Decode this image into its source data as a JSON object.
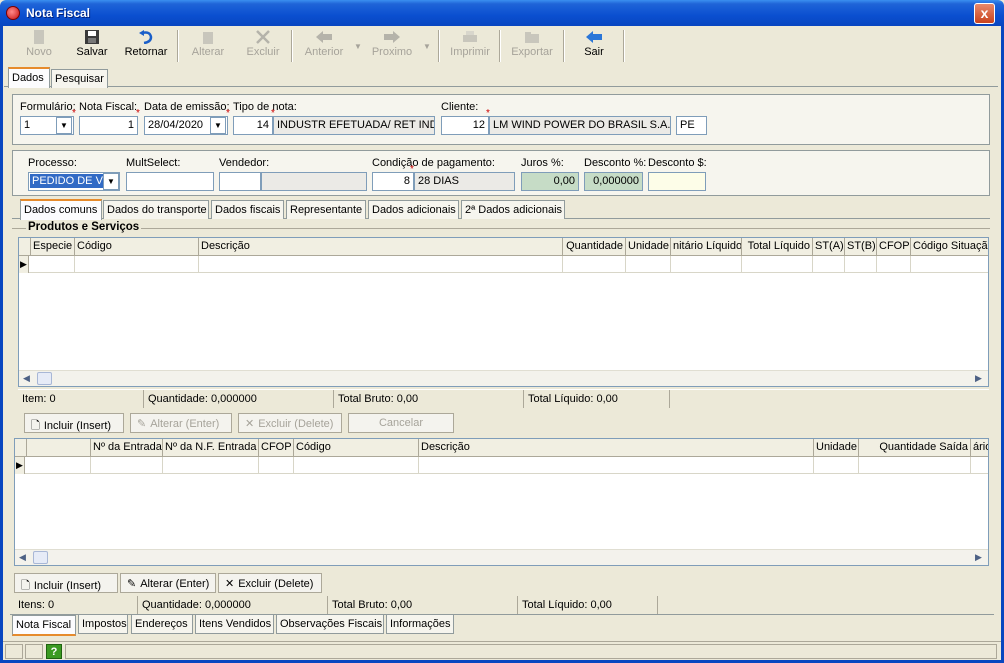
{
  "window": {
    "title": "Nota Fiscal",
    "close_label": "x"
  },
  "toolbar": {
    "novo": "Novo",
    "salvar": "Salvar",
    "retornar": "Retornar",
    "alterar": "Alterar",
    "excluir": "Excluir",
    "anterior": "Anterior",
    "proximo": "Proximo",
    "imprimir": "Imprimir",
    "exportar": "Exportar",
    "sair": "Sair"
  },
  "main_tabs": [
    "Dados",
    "Pesquisar"
  ],
  "header": {
    "formulario_label": "Formulário:",
    "formulario_value": "1",
    "nota_label": "Nota Fiscal:",
    "nota_value": "1",
    "data_label": "Data de emissão:",
    "data_value": "28/04/2020",
    "tipo_label": "Tipo de nota:",
    "tipo_code": "14",
    "tipo_desc": "INDUSTR EFETUADA/ RET IND",
    "cliente_label": "Cliente:",
    "cliente_code": "12",
    "cliente_name": "LM WIND POWER DO BRASIL S.A.",
    "cliente_uf": "PE"
  },
  "details": {
    "processo_label": "Processo:",
    "processo_value": "PEDIDO DE V",
    "multselect_label": "MultSelect:",
    "vendedor_label": "Vendedor:",
    "condicao_label": "Condição de pagamento:",
    "condicao_code": "8",
    "condicao_desc": "28 DIAS",
    "juros_label": "Juros %:",
    "juros_value": "0,00",
    "desconto_pct_label": "Desconto %:",
    "desconto_pct_value": "0,000000",
    "desconto_val_label": "Desconto $:"
  },
  "sub_tabs": [
    "Dados comuns",
    "Dados do transporte",
    "Dados fiscais",
    "Representante",
    "Dados adicionais",
    "2ª Dados adicionais"
  ],
  "produtos": {
    "title": "Produtos e Serviços",
    "columns": [
      "Especie",
      "Código",
      "Descrição",
      "Quantidade",
      "Unidade",
      "nitário Líquido",
      "Total Líquido",
      "ST(A)",
      "ST(B)",
      "CFOP",
      "Código Situaçã"
    ],
    "status": {
      "item": "Item: 0",
      "quantidade": "Quantidade: 0,000000",
      "total_bruto": "Total Bruto: 0,00",
      "total_liquido": "Total Líquido: 0,00"
    },
    "buttons": {
      "incluir": "Incluir (Insert)",
      "alterar": "Alterar (Enter)",
      "excluir": "Excluir (Delete)",
      "cancelar": "Cancelar"
    }
  },
  "entradas": {
    "columns": [
      "Nº da Entrada",
      "Nº da N.F. Entrada",
      "CFOP",
      "Código",
      "Descrição",
      "Unidade",
      "Quantidade Saída",
      "ário"
    ],
    "buttons": {
      "incluir": "Incluir (Insert)",
      "alterar": "Alterar (Enter)",
      "excluir": "Excluir (Delete)"
    },
    "status": {
      "itens": "Itens: 0",
      "quantidade": "Quantidade: 0,000000",
      "total_bruto": "Total Bruto: 0,00",
      "total_liquido": "Total Líquido: 0,00"
    }
  },
  "bottom_tabs": [
    "Nota Fiscal",
    "Impostos",
    "Endereços",
    "Itens Vendidos",
    "Observações Fiscais",
    "Informações"
  ],
  "statusbar": {
    "help": "?"
  }
}
